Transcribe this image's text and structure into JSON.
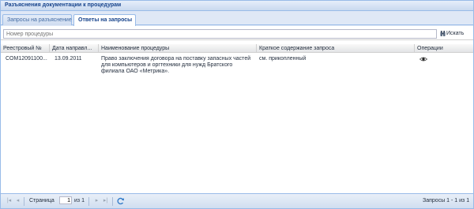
{
  "panel": {
    "title": "Разъяснения документации к процедурам"
  },
  "tabs": [
    {
      "label": "Запросы на разъяснение",
      "active": false
    },
    {
      "label": "Ответы на запросы",
      "active": true
    }
  ],
  "search": {
    "placeholder": "Номер процедуры",
    "button_label": "Искать"
  },
  "grid": {
    "columns": [
      "Реестровый №",
      "Дата направл...",
      "Наименование процедуры",
      "Краткое содержание запроса",
      "Операции"
    ],
    "rows": [
      {
        "reg_no": "COM12091100...",
        "date": "13.09.2011",
        "procedure": "Право заключения договора на поставку запасных частей для компьютеров и оргтехники для нужд Братского филиала ОАО «Метрика».",
        "summary": "см. прикопленный",
        "operation_icon": "eye-icon"
      }
    ]
  },
  "pager": {
    "page_label": "Страница",
    "page_value": "1",
    "of_label": "из 1",
    "status": "Запросы 1 - 1 из 1"
  },
  "colors": {
    "header_border": "#99bbe8",
    "title": "#15428b",
    "background": "#dfe8f6"
  }
}
